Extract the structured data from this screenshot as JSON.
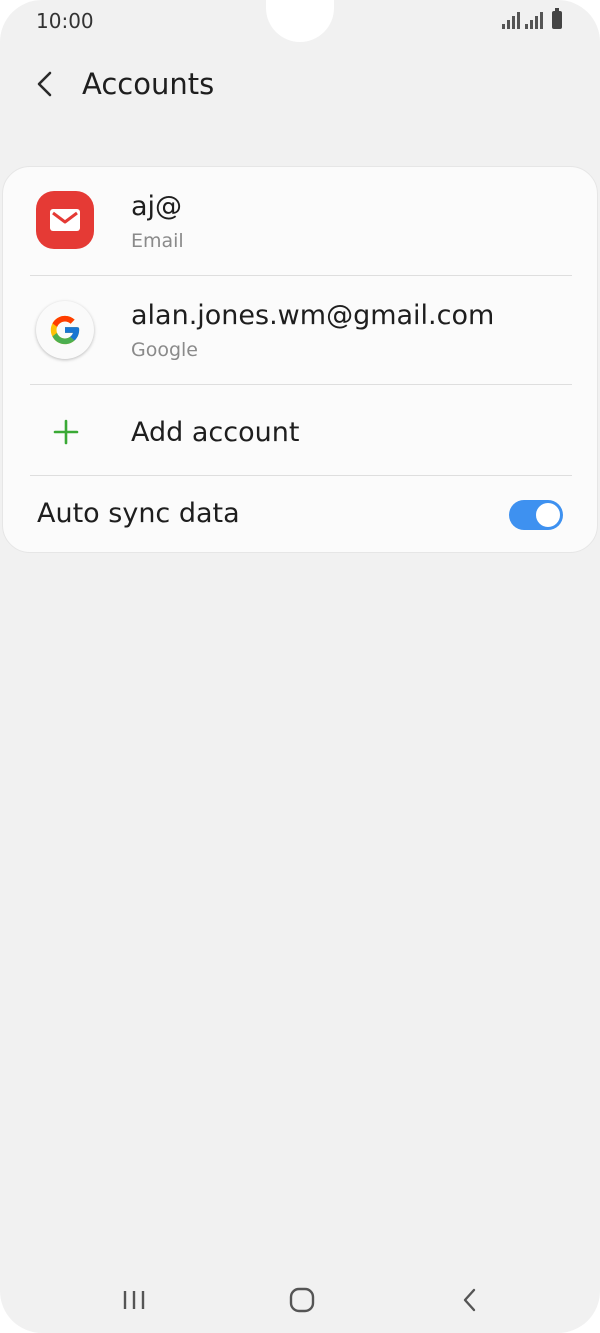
{
  "status_bar": {
    "time": "10:00"
  },
  "header": {
    "title": "Accounts"
  },
  "accounts": [
    {
      "primary": "aj@",
      "secondary": "Email",
      "icon": "email-icon",
      "color": "#e53a35"
    },
    {
      "primary": "alan.jones.wm@gmail.com",
      "secondary": "Google",
      "icon": "google-icon"
    }
  ],
  "add_account": {
    "label": "Add account",
    "icon": "plus-icon",
    "color": "#3aa935"
  },
  "auto_sync": {
    "label": "Auto sync data",
    "enabled": true,
    "color": "#3e91f0"
  },
  "nav": {
    "recents": "recents-icon",
    "home": "home-icon",
    "back": "back-icon"
  }
}
